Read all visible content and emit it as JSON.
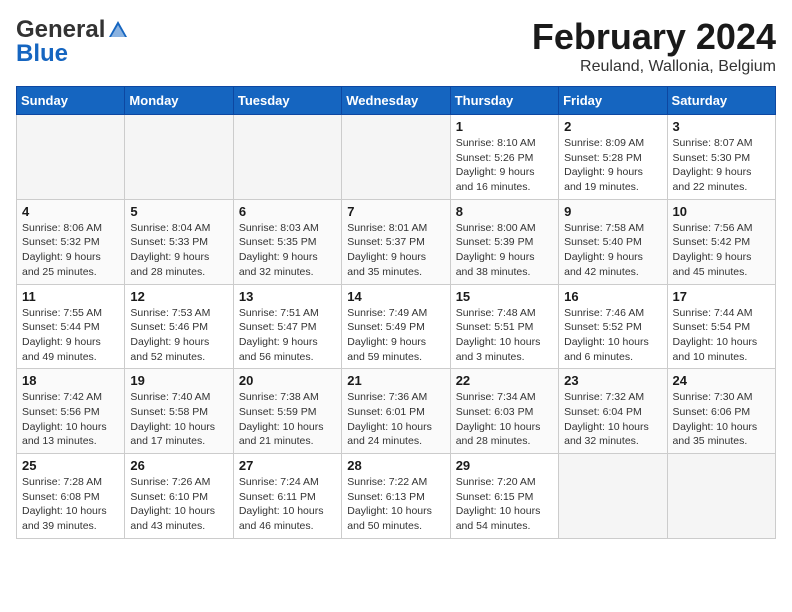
{
  "logo": {
    "line1": "General",
    "line2": "Blue"
  },
  "title": "February 2024",
  "location": "Reuland, Wallonia, Belgium",
  "weekdays": [
    "Sunday",
    "Monday",
    "Tuesday",
    "Wednesday",
    "Thursday",
    "Friday",
    "Saturday"
  ],
  "weeks": [
    [
      {
        "day": "",
        "empty": true
      },
      {
        "day": "",
        "empty": true
      },
      {
        "day": "",
        "empty": true
      },
      {
        "day": "",
        "empty": true
      },
      {
        "day": "1",
        "sunrise": "8:10 AM",
        "sunset": "5:26 PM",
        "daylight": "9 hours and 16 minutes."
      },
      {
        "day": "2",
        "sunrise": "8:09 AM",
        "sunset": "5:28 PM",
        "daylight": "9 hours and 19 minutes."
      },
      {
        "day": "3",
        "sunrise": "8:07 AM",
        "sunset": "5:30 PM",
        "daylight": "9 hours and 22 minutes."
      }
    ],
    [
      {
        "day": "4",
        "sunrise": "8:06 AM",
        "sunset": "5:32 PM",
        "daylight": "9 hours and 25 minutes."
      },
      {
        "day": "5",
        "sunrise": "8:04 AM",
        "sunset": "5:33 PM",
        "daylight": "9 hours and 28 minutes."
      },
      {
        "day": "6",
        "sunrise": "8:03 AM",
        "sunset": "5:35 PM",
        "daylight": "9 hours and 32 minutes."
      },
      {
        "day": "7",
        "sunrise": "8:01 AM",
        "sunset": "5:37 PM",
        "daylight": "9 hours and 35 minutes."
      },
      {
        "day": "8",
        "sunrise": "8:00 AM",
        "sunset": "5:39 PM",
        "daylight": "9 hours and 38 minutes."
      },
      {
        "day": "9",
        "sunrise": "7:58 AM",
        "sunset": "5:40 PM",
        "daylight": "9 hours and 42 minutes."
      },
      {
        "day": "10",
        "sunrise": "7:56 AM",
        "sunset": "5:42 PM",
        "daylight": "9 hours and 45 minutes."
      }
    ],
    [
      {
        "day": "11",
        "sunrise": "7:55 AM",
        "sunset": "5:44 PM",
        "daylight": "9 hours and 49 minutes."
      },
      {
        "day": "12",
        "sunrise": "7:53 AM",
        "sunset": "5:46 PM",
        "daylight": "9 hours and 52 minutes."
      },
      {
        "day": "13",
        "sunrise": "7:51 AM",
        "sunset": "5:47 PM",
        "daylight": "9 hours and 56 minutes."
      },
      {
        "day": "14",
        "sunrise": "7:49 AM",
        "sunset": "5:49 PM",
        "daylight": "9 hours and 59 minutes."
      },
      {
        "day": "15",
        "sunrise": "7:48 AM",
        "sunset": "5:51 PM",
        "daylight": "10 hours and 3 minutes."
      },
      {
        "day": "16",
        "sunrise": "7:46 AM",
        "sunset": "5:52 PM",
        "daylight": "10 hours and 6 minutes."
      },
      {
        "day": "17",
        "sunrise": "7:44 AM",
        "sunset": "5:54 PM",
        "daylight": "10 hours and 10 minutes."
      }
    ],
    [
      {
        "day": "18",
        "sunrise": "7:42 AM",
        "sunset": "5:56 PM",
        "daylight": "10 hours and 13 minutes."
      },
      {
        "day": "19",
        "sunrise": "7:40 AM",
        "sunset": "5:58 PM",
        "daylight": "10 hours and 17 minutes."
      },
      {
        "day": "20",
        "sunrise": "7:38 AM",
        "sunset": "5:59 PM",
        "daylight": "10 hours and 21 minutes."
      },
      {
        "day": "21",
        "sunrise": "7:36 AM",
        "sunset": "6:01 PM",
        "daylight": "10 hours and 24 minutes."
      },
      {
        "day": "22",
        "sunrise": "7:34 AM",
        "sunset": "6:03 PM",
        "daylight": "10 hours and 28 minutes."
      },
      {
        "day": "23",
        "sunrise": "7:32 AM",
        "sunset": "6:04 PM",
        "daylight": "10 hours and 32 minutes."
      },
      {
        "day": "24",
        "sunrise": "7:30 AM",
        "sunset": "6:06 PM",
        "daylight": "10 hours and 35 minutes."
      }
    ],
    [
      {
        "day": "25",
        "sunrise": "7:28 AM",
        "sunset": "6:08 PM",
        "daylight": "10 hours and 39 minutes."
      },
      {
        "day": "26",
        "sunrise": "7:26 AM",
        "sunset": "6:10 PM",
        "daylight": "10 hours and 43 minutes."
      },
      {
        "day": "27",
        "sunrise": "7:24 AM",
        "sunset": "6:11 PM",
        "daylight": "10 hours and 46 minutes."
      },
      {
        "day": "28",
        "sunrise": "7:22 AM",
        "sunset": "6:13 PM",
        "daylight": "10 hours and 50 minutes."
      },
      {
        "day": "29",
        "sunrise": "7:20 AM",
        "sunset": "6:15 PM",
        "daylight": "10 hours and 54 minutes."
      },
      {
        "day": "",
        "empty": true
      },
      {
        "day": "",
        "empty": true
      }
    ]
  ],
  "labels": {
    "sunrise_prefix": "Sunrise: ",
    "sunset_prefix": "Sunset: ",
    "daylight_prefix": "Daylight: "
  }
}
